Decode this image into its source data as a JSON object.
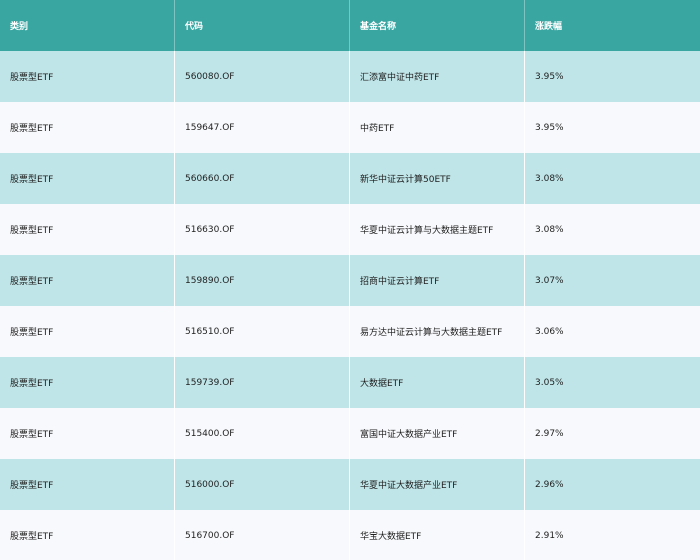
{
  "table": {
    "headers": {
      "category": "类别",
      "code": "代码",
      "fund_name": "基金名称",
      "change": "涨跌幅"
    },
    "rows": [
      {
        "category": "股票型ETF",
        "code": "560080.OF",
        "fund_name": "汇添富中证中药ETF",
        "change": "3.95%"
      },
      {
        "category": "股票型ETF",
        "code": "159647.OF",
        "fund_name": "中药ETF",
        "change": "3.95%"
      },
      {
        "category": "股票型ETF",
        "code": "560660.OF",
        "fund_name": "新华中证云计算50ETF",
        "change": "3.08%"
      },
      {
        "category": "股票型ETF",
        "code": "516630.OF",
        "fund_name": "华夏中证云计算与大数据主题ETF",
        "change": "3.08%"
      },
      {
        "category": "股票型ETF",
        "code": "159890.OF",
        "fund_name": "招商中证云计算ETF",
        "change": "3.07%"
      },
      {
        "category": "股票型ETF",
        "code": "516510.OF",
        "fund_name": "易方达中证云计算与大数据主题ETF",
        "change": "3.06%"
      },
      {
        "category": "股票型ETF",
        "code": "159739.OF",
        "fund_name": "大数据ETF",
        "change": "3.05%"
      },
      {
        "category": "股票型ETF",
        "code": "515400.OF",
        "fund_name": "富国中证大数据产业ETF",
        "change": "2.97%"
      },
      {
        "category": "股票型ETF",
        "code": "516000.OF",
        "fund_name": "华夏中证大数据产业ETF",
        "change": "2.96%"
      },
      {
        "category": "股票型ETF",
        "code": "516700.OF",
        "fund_name": "华宝大数据ETF",
        "change": "2.91%"
      }
    ]
  },
  "colors": {
    "header_bg": "#3aa6a2",
    "row_odd_bg": "#bfe5e8",
    "row_even_bg": "#f8f9fc"
  }
}
